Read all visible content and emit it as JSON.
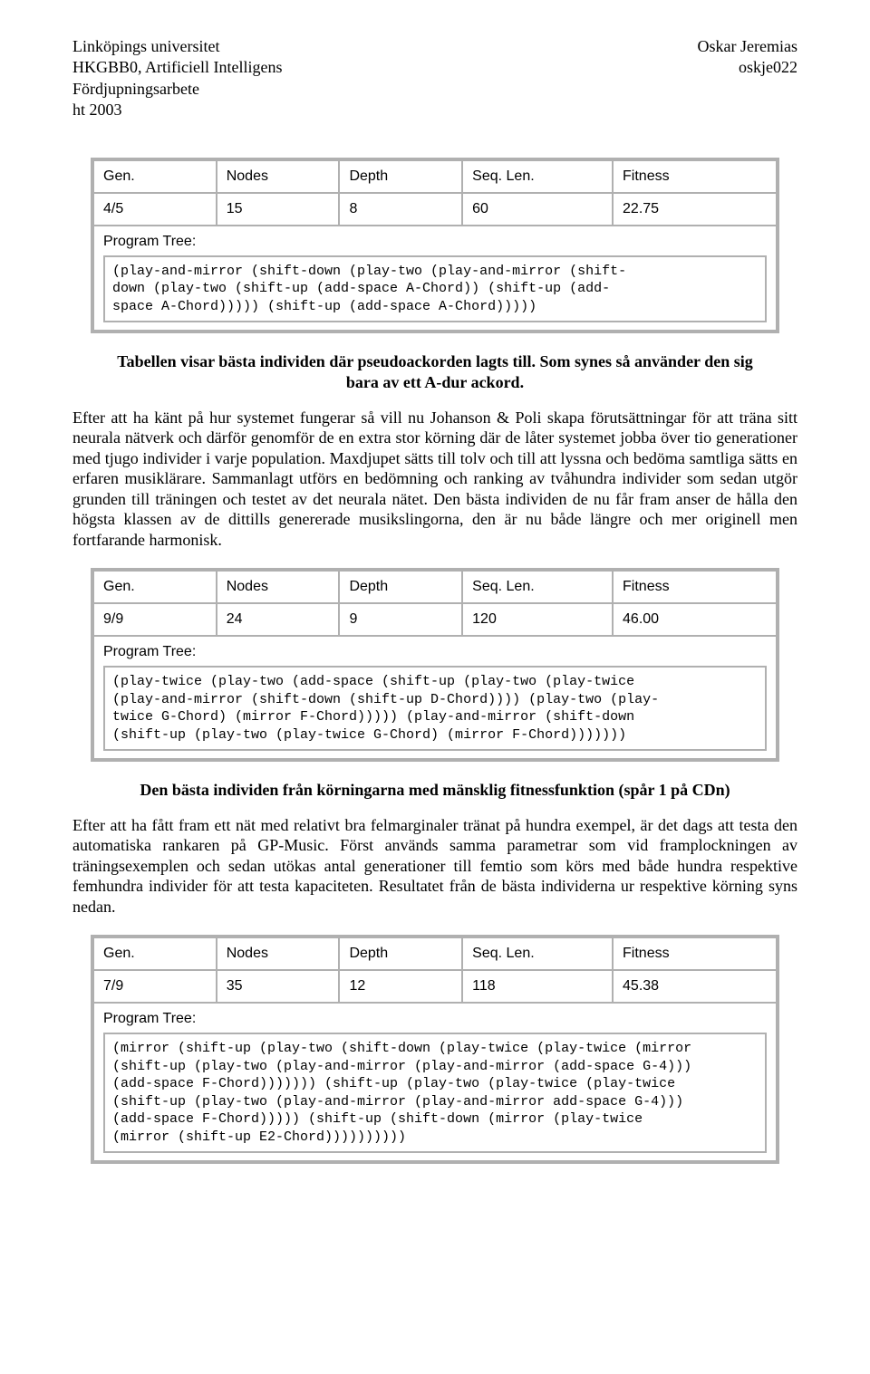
{
  "header": {
    "left": {
      "line1": "Linköpings universitet",
      "line2": "HKGBB0, Artificiell Intelligens",
      "line3": "Fördjupningsarbete",
      "line4": "ht 2003"
    },
    "right": {
      "line1": "Oskar Jeremias",
      "line2": "oskje022"
    }
  },
  "tables": {
    "headers": {
      "gen": "Gen.",
      "nodes": "Nodes",
      "depth": "Depth",
      "seq": "Seq. Len.",
      "fitness": "Fitness"
    },
    "program_tree_label": "Program Tree:",
    "t1": {
      "row": {
        "gen": "4/5",
        "nodes": "15",
        "depth": "8",
        "seq": "60",
        "fitness": "22.75"
      },
      "code": "(play-and-mirror (shift-down (play-two (play-and-mirror (shift-\ndown (play-two (shift-up (add-space A-Chord)) (shift-up (add-\nspace A-Chord))))) (shift-up (add-space A-Chord)))))"
    },
    "t2": {
      "row": {
        "gen": "9/9",
        "nodes": "24",
        "depth": "9",
        "seq": "120",
        "fitness": "46.00"
      },
      "code": "(play-twice (play-two (add-space (shift-up (play-two (play-twice\n(play-and-mirror (shift-down (shift-up D-Chord)))) (play-two (play-\ntwice G-Chord) (mirror F-Chord))))) (play-and-mirror (shift-down\n(shift-up (play-two (play-twice G-Chord) (mirror F-Chord)))))))"
    },
    "t3": {
      "row": {
        "gen": "7/9",
        "nodes": "35",
        "depth": "12",
        "seq": "118",
        "fitness": "45.38"
      },
      "code": "(mirror (shift-up (play-two (shift-down (play-twice (play-twice (mirror\n(shift-up (play-two (play-and-mirror (play-and-mirror (add-space G-4)))\n(add-space F-Chord))))))) (shift-up (play-two (play-twice (play-twice\n(shift-up (play-two (play-and-mirror (play-and-mirror add-space G-4)))\n(add-space F-Chord))))) (shift-up (shift-down (mirror (play-twice\n(mirror (shift-up E2-Chord))))))))))"
    }
  },
  "captions": {
    "c1": "Tabellen visar bästa individen där pseudoackorden lagts till. Som synes så använder den sig bara av ett A-dur ackord.",
    "c2": "Den bästa individen från körningarna med mänsklig fitnessfunktion (spår 1 på CDn)"
  },
  "paragraphs": {
    "p1": "Efter att ha känt på hur systemet fungerar så vill nu Johanson & Poli skapa förutsättningar för att träna sitt neurala nätverk och därför genomför de en extra stor körning där de låter systemet jobba över tio generationer med tjugo individer i varje population. Maxdjupet sätts till tolv och till att lyssna och bedöma samtliga sätts en erfaren musiklärare. Sammanlagt utförs en bedömning och ranking av tvåhundra individer som sedan utgör grunden till träningen och testet av det neurala nätet. Den bästa individen de nu får fram anser de hålla den högsta klassen av de dittills genererade musikslingorna, den är nu både längre och mer originell men fortfarande harmonisk.",
    "p2": "Efter att ha fått fram ett nät med relativt bra felmarginaler tränat på hundra exempel, är det dags att testa den automatiska rankaren på GP-Music. Först används samma parametrar som vid framplockningen av träningsexemplen och sedan utökas antal generationer till femtio som körs med både hundra respektive femhundra individer för att testa kapaciteten. Resultatet från de bästa individerna ur respektive körning syns nedan."
  }
}
